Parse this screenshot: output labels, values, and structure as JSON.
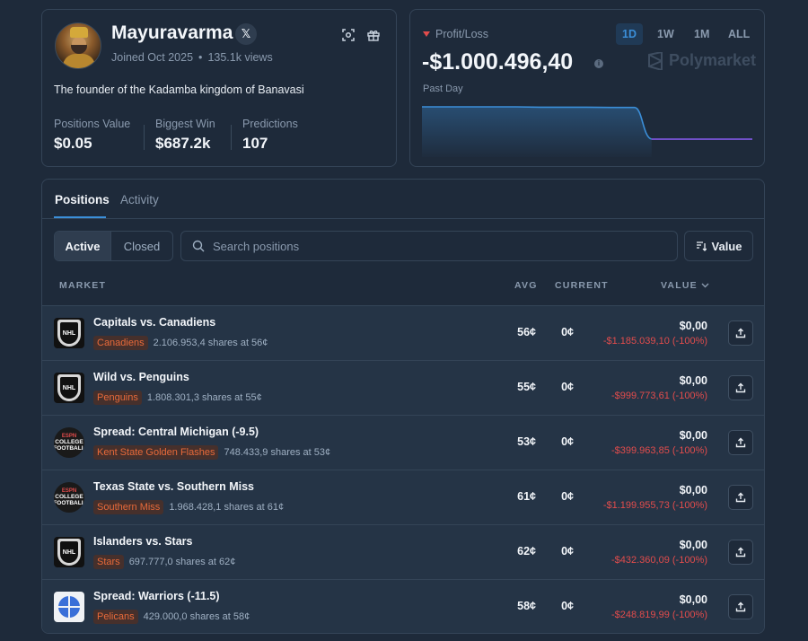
{
  "profile": {
    "name": "Mayuravarma",
    "x_badge": "𝕏",
    "joined": "Joined Oct 2025",
    "views": "135.1k views",
    "bio": "The founder of the Kadamba kingdom of Banavasi",
    "stats": [
      {
        "label": "Positions Value",
        "value": "$0.05"
      },
      {
        "label": "Biggest Win",
        "value": "$687.2k"
      },
      {
        "label": "Predictions",
        "value": "107"
      }
    ]
  },
  "pnl": {
    "label": "Profit/Loss",
    "value": "-$1.000.496,40",
    "period_label": "Past Day",
    "timeframes": [
      "1D",
      "1W",
      "1M",
      "ALL"
    ],
    "active_timeframe": "1D",
    "brand": "Polymarket",
    "series": [
      1.0,
      1.0,
      1.0,
      1.0,
      1.0,
      0.99,
      0.99,
      0.99,
      0.98,
      0.98,
      0.0,
      0.0,
      0.0,
      0.0,
      0.0
    ],
    "colors": {
      "before": "#3b8fd9",
      "after": "#8b5cf6"
    }
  },
  "tabs": [
    "Positions",
    "Activity"
  ],
  "filters": {
    "active": "Active",
    "closed": "Closed"
  },
  "search": {
    "placeholder": "Search positions",
    "value": ""
  },
  "sort": {
    "label": "Value"
  },
  "columns": {
    "market": "MARKET",
    "avg": "AVG",
    "current": "CURRENT",
    "value": "VALUE"
  },
  "positions": [
    {
      "title": "Capitals vs. Canadiens",
      "outcome": "Canadiens",
      "shares": "2.106.953,4 shares at 56¢",
      "avg": "56¢",
      "current": "0¢",
      "value": "$0,00",
      "pnl": "-$1.185.039,10 (-100%)",
      "logo": "nhl"
    },
    {
      "title": "Wild vs. Penguins",
      "outcome": "Penguins",
      "shares": "1.808.301,3 shares at 55¢",
      "avg": "55¢",
      "current": "0¢",
      "value": "$0,00",
      "pnl": "-$999.773,61 (-100%)",
      "logo": "nhl"
    },
    {
      "title": "Spread: Central Michigan (-9.5)",
      "outcome": "Kent State Golden Flashes",
      "shares": "748.433,9 shares at 53¢",
      "avg": "53¢",
      "current": "0¢",
      "value": "$0,00",
      "pnl": "-$399.963,85 (-100%)",
      "logo": "college-football"
    },
    {
      "title": "Texas State vs. Southern Miss",
      "outcome": "Southern Miss",
      "shares": "1.968.428,1 shares at 61¢",
      "avg": "61¢",
      "current": "0¢",
      "value": "$0,00",
      "pnl": "-$1.199.955,73 (-100%)",
      "logo": "college-football"
    },
    {
      "title": "Islanders vs. Stars",
      "outcome": "Stars",
      "shares": "697.777,0 shares at 62¢",
      "avg": "62¢",
      "current": "0¢",
      "value": "$0,00",
      "pnl": "-$432.360,09 (-100%)",
      "logo": "nhl"
    },
    {
      "title": "Spread: Warriors (-11.5)",
      "outcome": "Pelicans",
      "shares": "429.000,0 shares at 58¢",
      "avg": "58¢",
      "current": "0¢",
      "value": "$0,00",
      "pnl": "-$248.819,99 (-100%)",
      "logo": "nba"
    }
  ]
}
